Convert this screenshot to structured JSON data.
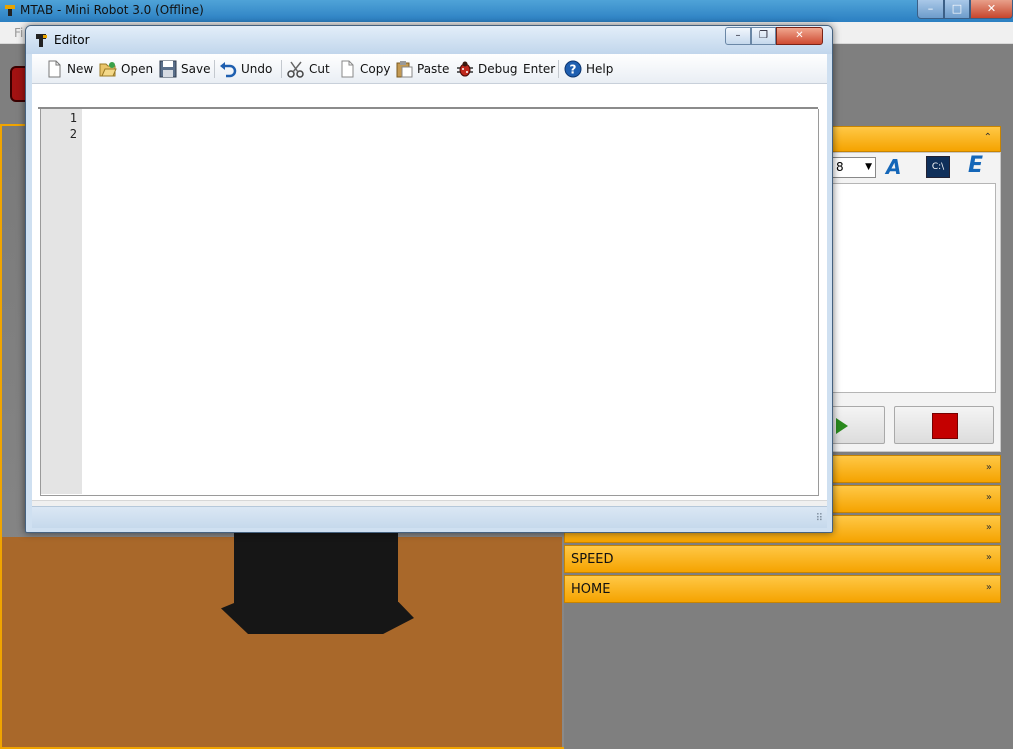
{
  "main_window": {
    "title": "MTAB - Mini Robot 3.0 (Offline)",
    "menu": [
      "Fi"
    ],
    "controls": {
      "minimize": "–",
      "maximize": "□",
      "close": "✕"
    }
  },
  "right_panel": {
    "header_chevron": "⌃",
    "speed_value": "8",
    "sections": [
      {
        "label": "",
        "chevron": "»"
      },
      {
        "label": "",
        "chevron": "»"
      },
      {
        "label": "",
        "chevron": "»"
      },
      {
        "label": "SPEED",
        "chevron": "»"
      },
      {
        "label": "HOME",
        "chevron": "»"
      }
    ]
  },
  "editor": {
    "title": "Editor",
    "toolbar": {
      "new": "New",
      "open": "Open",
      "save": "Save",
      "undo": "Undo",
      "cut": "Cut",
      "copy": "Copy",
      "paste": "Paste",
      "debug": "Debug",
      "enter": "Enter",
      "help": "Help"
    },
    "line_numbers": [
      "1",
      "2"
    ],
    "code": ""
  },
  "icons": {
    "new": "document-icon",
    "open": "folder-open-icon",
    "save": "floppy-disk-icon",
    "undo": "undo-arrow-icon",
    "cut": "scissors-icon",
    "copy": "copy-icon",
    "paste": "clipboard-icon",
    "debug": "bug-icon",
    "help": "help-icon"
  },
  "colors": {
    "accent_orange": "#f5a300",
    "titlebar_blue": "#2b7fc2",
    "floor_brown": "#a9682a",
    "stop_red": "#c40000"
  }
}
